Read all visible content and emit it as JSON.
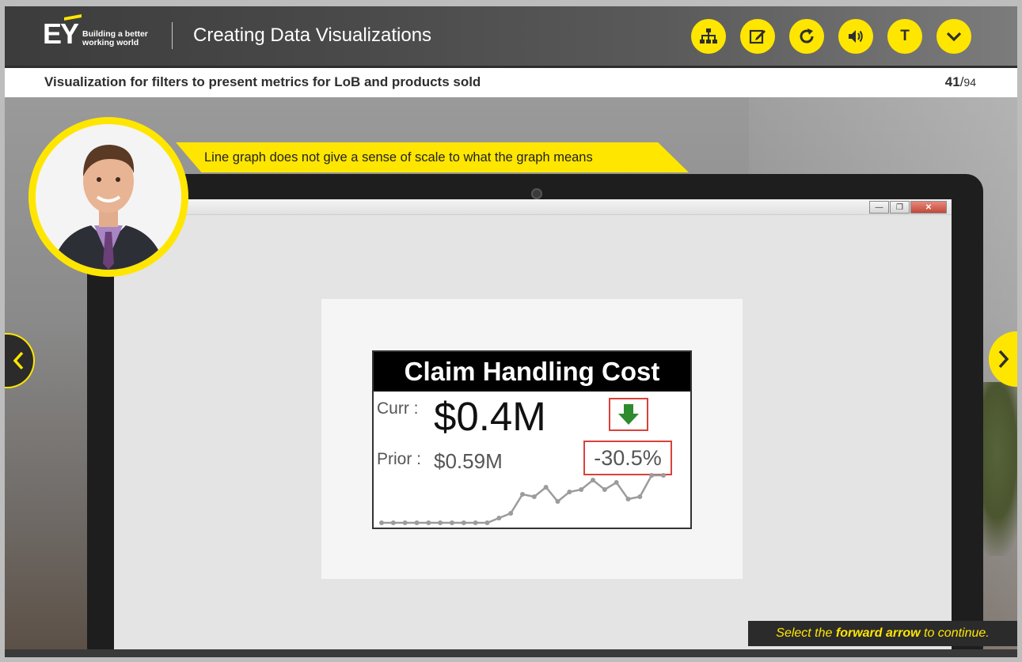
{
  "header": {
    "logo_mark": "EY",
    "logo_tagline_line1": "Building a better",
    "logo_tagline_line2": "working world",
    "course_title": "Creating Data Visualizations"
  },
  "toolbar": {
    "buttons": [
      "sitemap",
      "notes",
      "replay",
      "audio",
      "transcript",
      "menu"
    ],
    "transcript_label": "T"
  },
  "slide": {
    "title": "Visualization for filters to present metrics for LoB and products sold",
    "page_current": "41",
    "page_separator": "/",
    "page_total": "94"
  },
  "presenter": {
    "caption": "Line graph does not give a sense of scale to what the graph means"
  },
  "kpi_card": {
    "title": "Claim Handling Cost",
    "curr_label": "Curr :",
    "curr_value": "$0.4M",
    "prior_label": "Prior :",
    "prior_value": "$0.59M",
    "change": "-30.5%",
    "trend": "down",
    "arrow_color": "#2e8b2e",
    "highlight_color": "#d9423a"
  },
  "chart_data": {
    "type": "line",
    "title": "",
    "xlabel": "",
    "ylabel": "",
    "x": [
      1,
      2,
      3,
      4,
      5,
      6,
      7,
      8,
      9,
      10,
      11,
      12,
      13,
      14,
      15,
      16,
      17,
      18,
      19,
      20,
      21,
      22,
      23,
      24,
      25
    ],
    "values": [
      0.0,
      0.0,
      0.0,
      0.0,
      0.0,
      0.0,
      0.0,
      0.0,
      0.0,
      0.0,
      0.1,
      0.2,
      0.6,
      0.55,
      0.75,
      0.45,
      0.65,
      0.7,
      0.9,
      0.7,
      0.85,
      0.5,
      0.55,
      1.0,
      1.0
    ],
    "ylim": [
      0,
      1
    ],
    "grid": false,
    "color": "#9c9c9c"
  },
  "footer": {
    "continue_pre": "Select the ",
    "continue_bold": "forward arrow",
    "continue_post": " to continue."
  },
  "colors": {
    "accent": "#ffe600",
    "dark": "#2e2e2e"
  }
}
